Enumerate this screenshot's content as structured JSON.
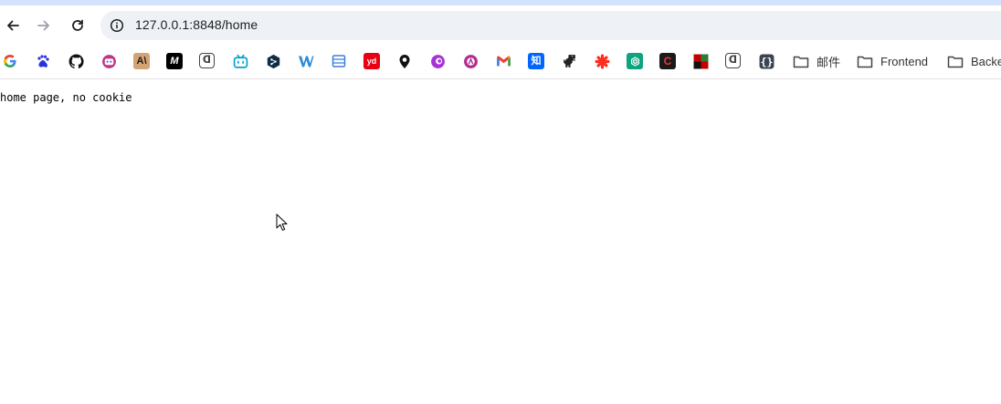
{
  "browser": {
    "address_bar": {
      "url": "127.0.0.1:8848/home"
    },
    "nav": {
      "back_icon": "arrow-left-icon",
      "forward_icon": "arrow-right-icon",
      "reload_icon": "reload-icon"
    },
    "bookmarks": [
      {
        "icon": "google-icon",
        "color": "#4285f4"
      },
      {
        "icon": "baidu-icon",
        "color": "#2932e1"
      },
      {
        "icon": "github-icon",
        "color": "#111111"
      },
      {
        "icon": "bot-icon",
        "color": "#c13584"
      },
      {
        "icon": "anthropic-icon",
        "color": "#d4a373"
      },
      {
        "icon": "medium-icon",
        "color": "#000000"
      },
      {
        "icon": "dash-icon",
        "color": "#444444"
      },
      {
        "icon": "bilibili-icon",
        "color": "#00a1d6"
      },
      {
        "icon": "deepl-icon",
        "color": "#0f2b46"
      },
      {
        "icon": "w-icon",
        "color": "#2a8bd8"
      },
      {
        "icon": "sheet-icon",
        "color": "#3b7ddd"
      },
      {
        "icon": "youdao-icon",
        "color": "#e60012"
      },
      {
        "icon": "location-icon",
        "color": "#111111"
      },
      {
        "icon": "purple-swirl-icon",
        "color": "#a633d6"
      },
      {
        "icon": "pink-circle-icon",
        "color": "#b12c8f"
      },
      {
        "icon": "gmail-icon",
        "color": "#ea4335"
      },
      {
        "icon": "zhihu-icon",
        "color": "#0066ff"
      },
      {
        "icon": "dino-icon",
        "color": "#222222"
      },
      {
        "icon": "star-icon",
        "color": "#ff2d20"
      },
      {
        "icon": "chatgpt-icon",
        "color": "#10a37f"
      },
      {
        "icon": "c-icon",
        "color": "#1a1a1a"
      },
      {
        "icon": "red-square-icon",
        "color": "#c40000"
      },
      {
        "icon": "dash-icon-2",
        "color": "#444444"
      },
      {
        "icon": "braces-icon",
        "color": "#3b4252"
      }
    ],
    "folders": [
      {
        "icon": "folder-icon",
        "label": "邮件"
      },
      {
        "icon": "folder-icon",
        "label": "Frontend"
      },
      {
        "icon": "folder-icon",
        "label": "Backe"
      }
    ]
  },
  "page": {
    "body_text": "home page, no cookie"
  },
  "colors": {
    "top_strip": "#d3e3fd",
    "omnibox": "#eef1f6",
    "text": "#000000"
  }
}
